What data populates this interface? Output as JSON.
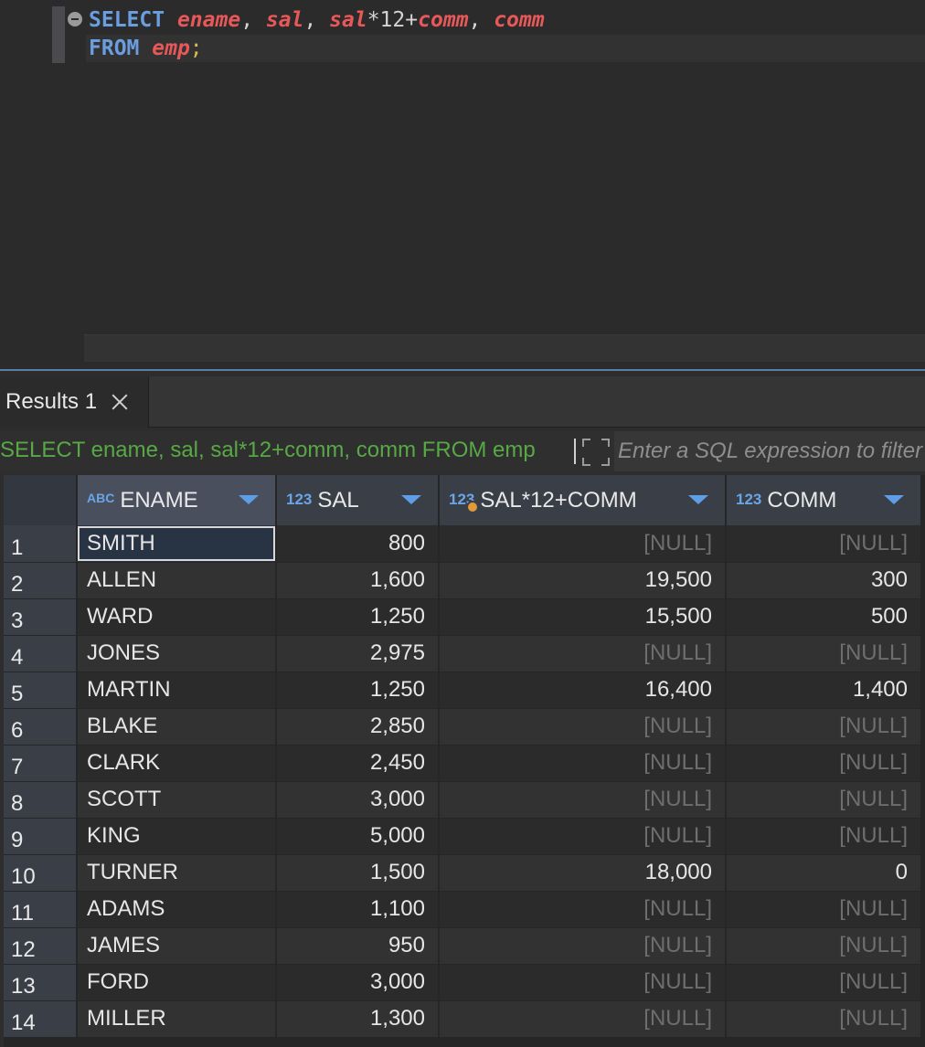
{
  "editor": {
    "line1": [
      {
        "t": "SELECT",
        "c": "kw"
      },
      {
        "t": " ",
        "c": "punc"
      },
      {
        "t": "ename",
        "c": "col"
      },
      {
        "t": ", ",
        "c": "punc"
      },
      {
        "t": "sal",
        "c": "col"
      },
      {
        "t": ", ",
        "c": "punc"
      },
      {
        "t": "sal",
        "c": "col"
      },
      {
        "t": "*12+",
        "c": "punc"
      },
      {
        "t": "comm",
        "c": "col"
      },
      {
        "t": ", ",
        "c": "punc"
      },
      {
        "t": "comm",
        "c": "col"
      }
    ],
    "line2": [
      {
        "t": "FROM",
        "c": "kw"
      },
      {
        "t": " ",
        "c": "punc"
      },
      {
        "t": "emp",
        "c": "col"
      },
      {
        "t": ";",
        "c": "semi"
      }
    ]
  },
  "results_tab": {
    "label": "Results 1"
  },
  "filter": {
    "query_text": "SELECT ename, sal, sal*12+comm, comm FROM emp",
    "placeholder": "Enter a SQL expression to filter results (use Ctrl+Space)"
  },
  "grid": {
    "columns": [
      {
        "name": "ENAME",
        "type_badge": "ABC",
        "align": "left"
      },
      {
        "name": "SAL",
        "type_badge": "123",
        "align": "right"
      },
      {
        "name": "SAL*12+COMM",
        "type_badge": "123",
        "align": "right"
      },
      {
        "name": "COMM",
        "type_badge": "123",
        "align": "right"
      }
    ],
    "rows": [
      {
        "n": "1",
        "ename": "SMITH",
        "sal": "800",
        "annual": "[NULL]",
        "comm": "[NULL]"
      },
      {
        "n": "2",
        "ename": "ALLEN",
        "sal": "1,600",
        "annual": "19,500",
        "comm": "300"
      },
      {
        "n": "3",
        "ename": "WARD",
        "sal": "1,250",
        "annual": "15,500",
        "comm": "500"
      },
      {
        "n": "4",
        "ename": "JONES",
        "sal": "2,975",
        "annual": "[NULL]",
        "comm": "[NULL]"
      },
      {
        "n": "5",
        "ename": "MARTIN",
        "sal": "1,250",
        "annual": "16,400",
        "comm": "1,400"
      },
      {
        "n": "6",
        "ename": "BLAKE",
        "sal": "2,850",
        "annual": "[NULL]",
        "comm": "[NULL]"
      },
      {
        "n": "7",
        "ename": "CLARK",
        "sal": "2,450",
        "annual": "[NULL]",
        "comm": "[NULL]"
      },
      {
        "n": "8",
        "ename": "SCOTT",
        "sal": "3,000",
        "annual": "[NULL]",
        "comm": "[NULL]"
      },
      {
        "n": "9",
        "ename": "KING",
        "sal": "5,000",
        "annual": "[NULL]",
        "comm": "[NULL]"
      },
      {
        "n": "10",
        "ename": "TURNER",
        "sal": "1,500",
        "annual": "18,000",
        "comm": "0"
      },
      {
        "n": "11",
        "ename": "ADAMS",
        "sal": "1,100",
        "annual": "[NULL]",
        "comm": "[NULL]"
      },
      {
        "n": "12",
        "ename": "JAMES",
        "sal": "950",
        "annual": "[NULL]",
        "comm": "[NULL]"
      },
      {
        "n": "13",
        "ename": "FORD",
        "sal": "3,000",
        "annual": "[NULL]",
        "comm": "[NULL]"
      },
      {
        "n": "14",
        "ename": "MILLER",
        "sal": "1,300",
        "annual": "[NULL]",
        "comm": "[NULL]"
      }
    ],
    "selected_row": 0
  },
  "colors": {
    "keyword": "#6a9ee0",
    "identifier": "#e85858",
    "query_text": "#58a846",
    "null_text": "#6e6e6e",
    "accent": "#5d9ee6"
  }
}
